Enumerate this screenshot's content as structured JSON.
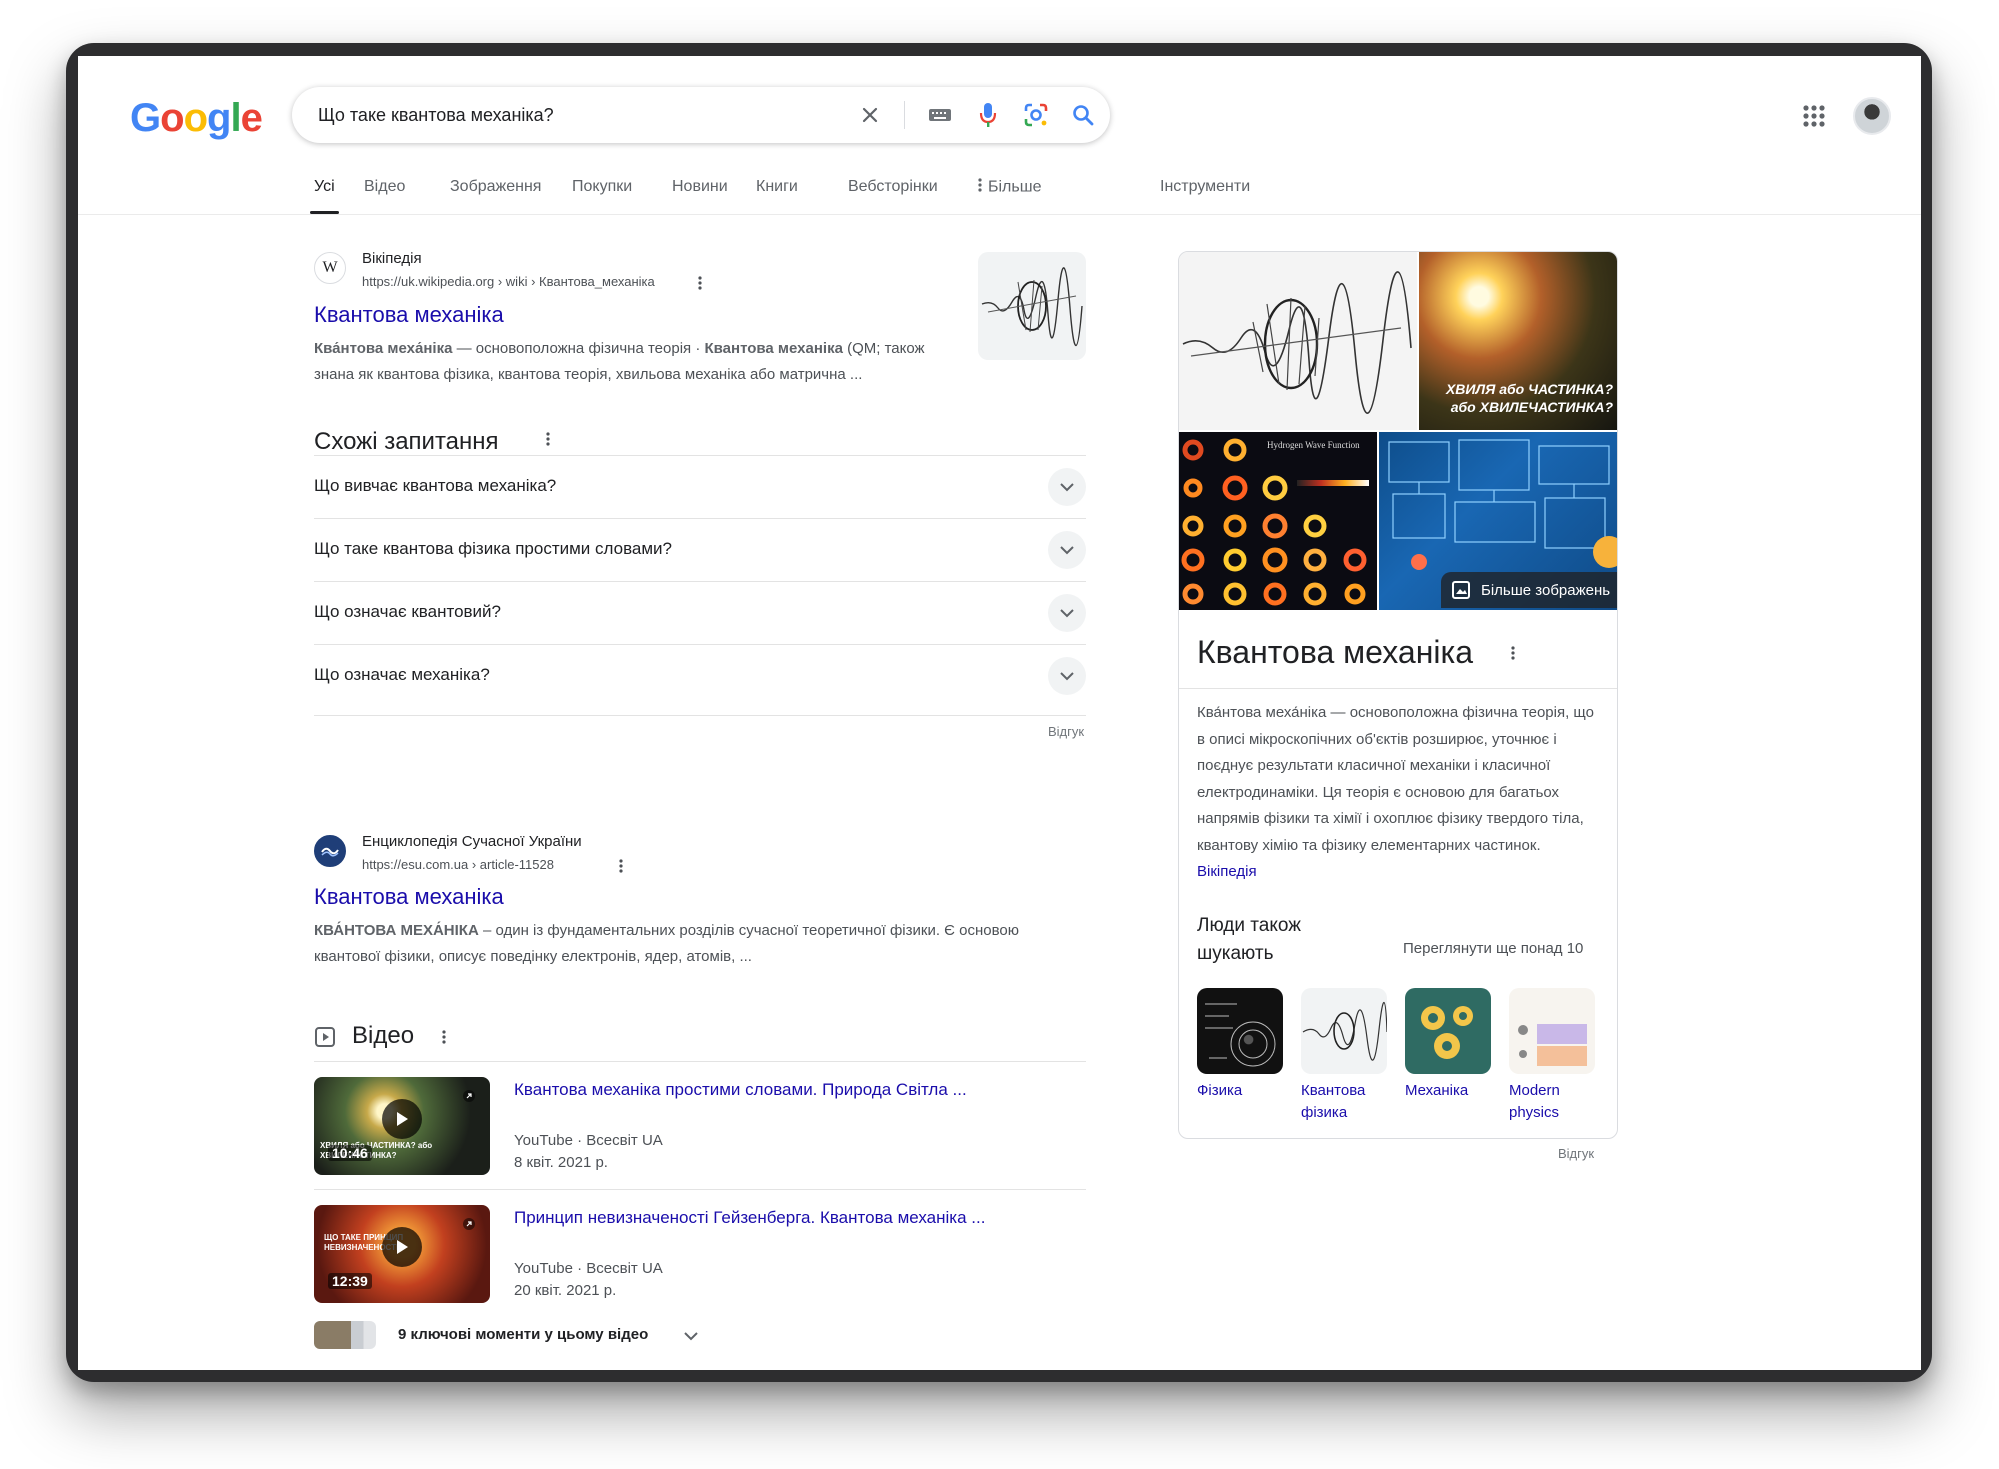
{
  "header": {
    "logo_letters": [
      "G",
      "o",
      "o",
      "g",
      "l",
      "e"
    ],
    "search_query": "Що таке квантова механіка?"
  },
  "tabs": [
    {
      "label": "Усі",
      "active": true
    },
    {
      "label": "Відео"
    },
    {
      "label": "Зображення"
    },
    {
      "label": "Покупки"
    },
    {
      "label": "Новини"
    },
    {
      "label": "Книги"
    },
    {
      "label": "Вебсторінки"
    },
    {
      "label": "Більше"
    },
    {
      "label": "Інструменти"
    }
  ],
  "results": [
    {
      "source_icon": "W",
      "source_name": "Вікіпедія",
      "url": "https://uk.wikipedia.org › wiki › Квантова_механіка",
      "title": "Квантова механіка",
      "snippet_b1": "Ква́нтова меха́ніка",
      "snippet_t1": " — основоположна фізична теорія · ",
      "snippet_b2": "Квантова механіка",
      "snippet_t2": " (QM; також знана як квантова фізика, квантова теорія, хвильова механіка або матрична ..."
    },
    {
      "source_name": "Енциклопедія Сучасної України",
      "url": "https://esu.com.ua › article-11528",
      "title": "Квантова механіка",
      "snippet_b1": "КВА́НТОВА МЕХА́НІКА",
      "snippet_t1": " – один із фундаментальних розділів сучасної теоретичної фізики. Є основою квантової фізики, описує поведінку електронів, ядер, атомів, ..."
    }
  ],
  "paa": {
    "heading": "Схожі запитання",
    "questions": [
      "Що вивчає квантова механіка?",
      "Що таке квантова фізика простими словами?",
      "Що означає квантовий?",
      "Що означає механіка?"
    ],
    "feedback": "Відгук"
  },
  "videos": {
    "heading": "Відео",
    "items": [
      {
        "title": "Квантова механіка простими словами. Природа Світла ...",
        "source": "YouTube · Всесвіт UA",
        "date": "8 квіт. 2021 р.",
        "duration": "10:46",
        "thumb_text": "ХВИЛЯ або ЧАСТИНКА? або ХВИЛЕЧАСТИНКА?"
      },
      {
        "title": "Принцип невизначеності Гейзенберга. Квантова механіка ...",
        "source": "YouTube · Всесвіт UA",
        "date": "20 квіт. 2021 р.",
        "duration": "12:39",
        "thumb_text": "ЩО ТАКЕ ПРИНЦИП НЕВИЗНАЧЕНОСТІ?"
      }
    ],
    "key_moments": "9 ключові моменти у цьому відео"
  },
  "knowledge_panel": {
    "more_images": "Більше зображень",
    "image_caption": "ХВИЛЯ або ЧАСТИНКА? або ХВИЛЕЧАСТИНКА?",
    "hydrogen_caption": "Hydrogen Wave Function",
    "title": "Квантова механіка",
    "description": "Ква́нтова меха́ніка — основоположна фізична теорія, що в описі мікроскопічних об'єктів розширює, уточнює і поєднує результати класичної механіки і класичної електродинаміки. Ця теорія є основою для багатьох напрямів фізики та хімії і охоплює фізику твердого тіла, квантову хімію та фізику елементарних частинок.",
    "description_link": "Вікіпедія",
    "people_also_search": "Люди також шукають",
    "see_more": "Переглянути ще понад 10",
    "related": [
      {
        "label": "Фізика"
      },
      {
        "label": "Квантова фізика"
      },
      {
        "label": "Механіка"
      },
      {
        "label": "Modern physics"
      }
    ],
    "feedback": "Відгук"
  },
  "colors": {
    "link": "#1a0dab",
    "google_blue": "#4285f4",
    "google_red": "#ea4335",
    "google_yellow": "#fbbc05",
    "google_green": "#34a853"
  }
}
